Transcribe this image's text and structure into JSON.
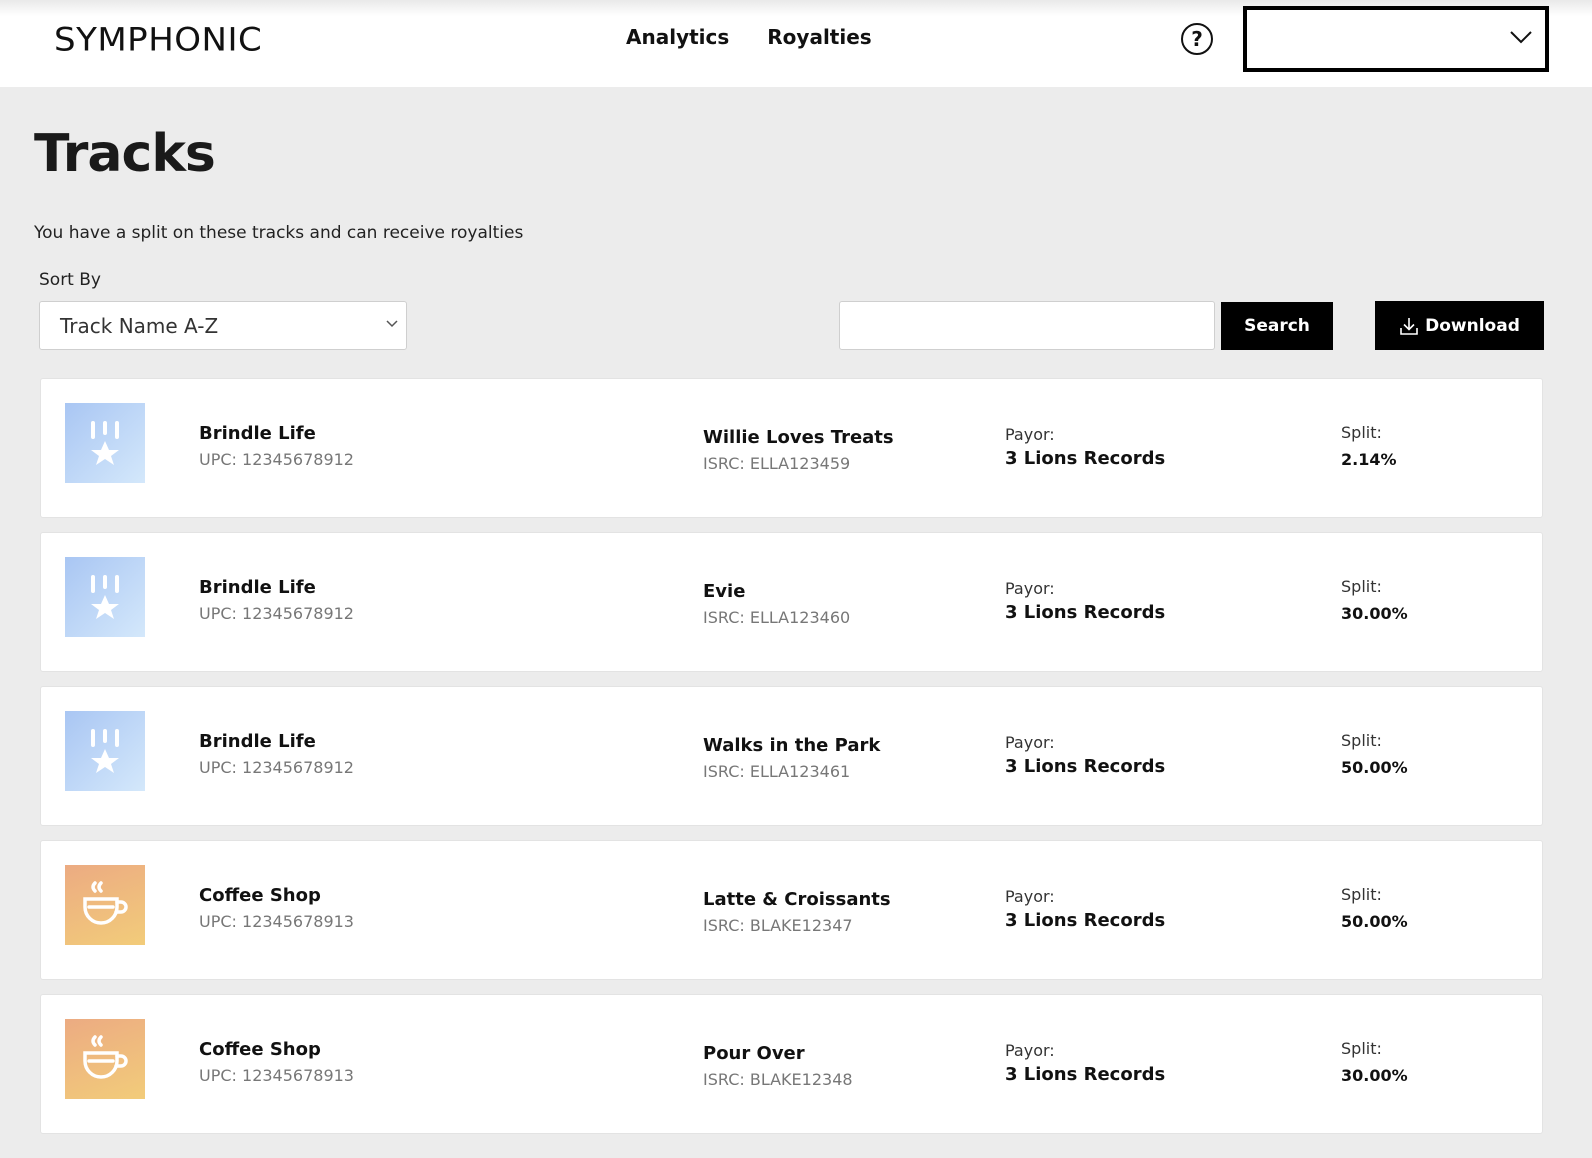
{
  "header": {
    "logo": "SYMPHONIC",
    "nav": [
      {
        "label": "Analytics"
      },
      {
        "label": "Royalties"
      }
    ],
    "help_glyph": "?",
    "account_select_value": ""
  },
  "main": {
    "title": "Tracks",
    "subtitle": "You have a split on these tracks and can receive royalties",
    "sort_label": "Sort By",
    "sort_value": "Track Name A-Z",
    "search_value": "",
    "search_label": "Search",
    "download_label": "Download"
  },
  "tracks": [
    {
      "release": "Brindle Life",
      "upc": "UPC: 12345678912",
      "track": "Willie Loves Treats",
      "isrc": "ISRC: ELLA123459",
      "payor_label": "Payor:",
      "payor": "3 Lions Records",
      "split_label": "Split:",
      "split": "2.14%",
      "cover": "blue",
      "cover_icon": "medal-icon"
    },
    {
      "release": "Brindle Life",
      "upc": "UPC: 12345678912",
      "track": "Evie",
      "isrc": "ISRC: ELLA123460",
      "payor_label": "Payor:",
      "payor": "3 Lions Records",
      "split_label": "Split:",
      "split": "30.00%",
      "cover": "blue",
      "cover_icon": "medal-icon"
    },
    {
      "release": "Brindle Life",
      "upc": "UPC: 12345678912",
      "track": "Walks in the Park",
      "isrc": "ISRC: ELLA123461",
      "payor_label": "Payor:",
      "payor": "3 Lions Records",
      "split_label": "Split:",
      "split": "50.00%",
      "cover": "blue",
      "cover_icon": "medal-icon"
    },
    {
      "release": "Coffee Shop",
      "upc": "UPC: 12345678913",
      "track": "Latte & Croissants",
      "isrc": "ISRC: BLAKE12347",
      "payor_label": "Payor:",
      "payor": "3 Lions Records",
      "split_label": "Split:",
      "split": "50.00%",
      "cover": "orange",
      "cover_icon": "coffee-cup-icon"
    },
    {
      "release": "Coffee Shop",
      "upc": "UPC: 12345678913",
      "track": "Pour Over",
      "isrc": "ISRC: BLAKE12348",
      "payor_label": "Payor:",
      "payor": "3 Lions Records",
      "split_label": "Split:",
      "split": "30.00%",
      "cover": "orange",
      "cover_icon": "coffee-cup-icon"
    }
  ]
}
